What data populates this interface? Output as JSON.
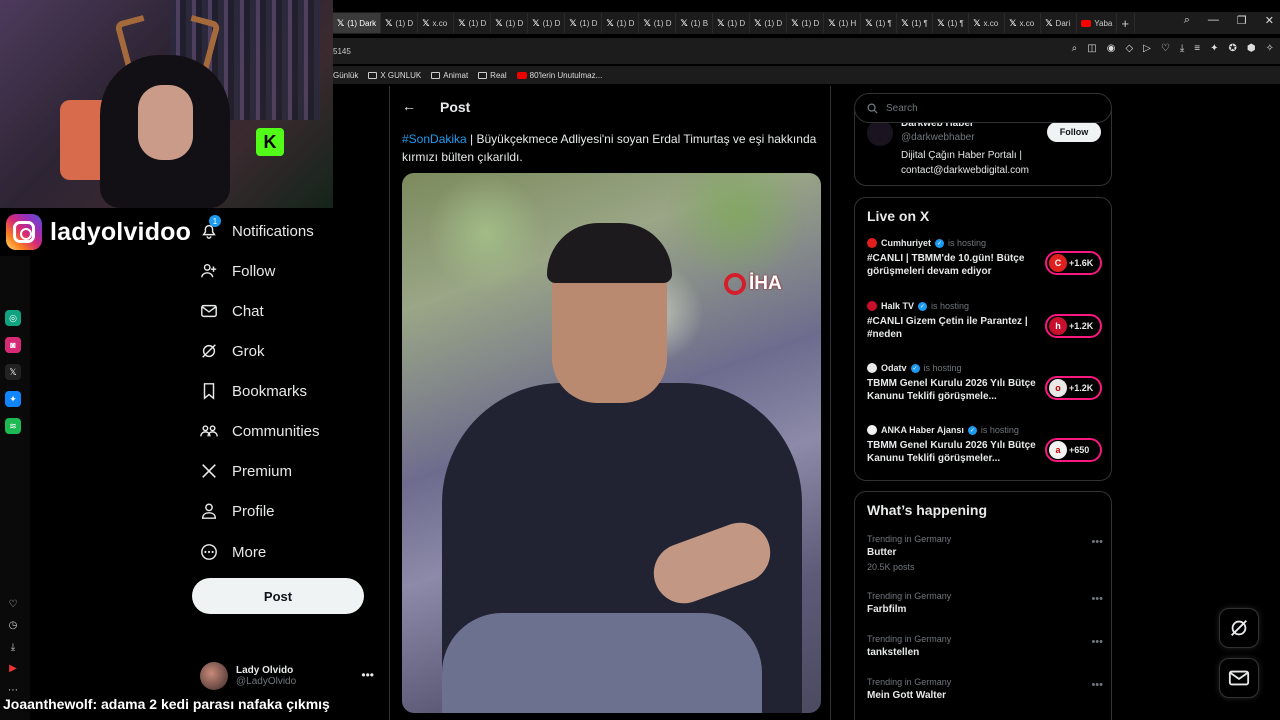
{
  "browser": {
    "tabs": [
      {
        "label": "(1) Dark",
        "icon": "x"
      },
      {
        "label": "(1) D",
        "icon": "x"
      },
      {
        "label": "x.co",
        "icon": "x"
      },
      {
        "label": "(1) D",
        "icon": "x"
      },
      {
        "label": "(1) D",
        "icon": "x"
      },
      {
        "label": "(1) D",
        "icon": "x"
      },
      {
        "label": "(1) D",
        "icon": "x"
      },
      {
        "label": "(1) D",
        "icon": "x"
      },
      {
        "label": "(1) D",
        "icon": "x"
      },
      {
        "label": "(1) B",
        "icon": "x"
      },
      {
        "label": "(1) D",
        "icon": "x"
      },
      {
        "label": "(1) D",
        "icon": "x"
      },
      {
        "label": "(1) D",
        "icon": "x"
      },
      {
        "label": "(1) H",
        "icon": "x"
      },
      {
        "label": "(1) ¶",
        "icon": "x"
      },
      {
        "label": "(1) ¶",
        "icon": "x"
      },
      {
        "label": "(1) ¶",
        "icon": "x"
      },
      {
        "label": "x.co",
        "icon": "x"
      },
      {
        "label": "x.co",
        "icon": "x"
      },
      {
        "label": "Dari",
        "icon": "x"
      },
      {
        "label": "Yaba",
        "icon": "youtube"
      }
    ],
    "url_fragment": "5145",
    "bookmarks": [
      {
        "label": "Günlük",
        "icon": "none"
      },
      {
        "label": "X GUNLUK",
        "icon": "folder"
      },
      {
        "label": "Animat",
        "icon": "folder"
      },
      {
        "label": "Real",
        "icon": "folder"
      },
      {
        "label": "80'lerin Unutulmaz...",
        "icon": "youtube"
      }
    ]
  },
  "overlay": {
    "instagram_handle": "ladyolvidoo",
    "chat_user": "Joaanthewolf:",
    "chat_text": "adama 2 kedi parası nafaka çıkmış",
    "kick_letter": "K"
  },
  "nav": {
    "notifications_badge": "1",
    "items": [
      {
        "label": "Notifications",
        "icon": "bell-icon"
      },
      {
        "label": "Follow",
        "icon": "person-plus-icon"
      },
      {
        "label": "Chat",
        "icon": "mail-icon"
      },
      {
        "label": "Grok",
        "icon": "grok-icon"
      },
      {
        "label": "Bookmarks",
        "icon": "bookmark-icon"
      },
      {
        "label": "Communities",
        "icon": "people-icon"
      },
      {
        "label": "Premium",
        "icon": "x-logo-icon"
      },
      {
        "label": "Profile",
        "icon": "person-icon"
      },
      {
        "label": "More",
        "icon": "more-circle-icon"
      }
    ],
    "post_button": "Post",
    "profile": {
      "name": "Lady Olvido",
      "handle": "@LadyOlvido"
    }
  },
  "post": {
    "header_title": "Post",
    "hashtag": "#SonDakika",
    "text": " | Büyükçekmece Adliyesi'ni soyan Erdal Timurtaş ve eşi hakkında kırmızı bülten çıkarıldı.",
    "watermark": "İHA"
  },
  "sidebar": {
    "search_placeholder": "Search",
    "follow_card": {
      "name": "Darkweb Haber",
      "handle": "@darkwebhaber",
      "bio": "Dijital Çağın Haber Portalı | contact@darkwebdigital.com",
      "follow_label": "Follow"
    },
    "live_title": "Live on X",
    "live": [
      {
        "host": "Cumhuriyet",
        "status": "is hosting",
        "title": "#CANLI | TBMM'de 10.gün! Bütçe görüşmeleri devam ediyor",
        "count": "+1.6K",
        "color": "#e0201e",
        "glyph": "C"
      },
      {
        "host": "Halk TV",
        "status": "is hosting",
        "title": "#CANLI Gizem Çetin ile Parantez | #neden",
        "count": "+1.2K",
        "color": "#c8102e",
        "glyph": "h"
      },
      {
        "host": "Odatv",
        "status": "is hosting",
        "title": "TBMM Genel Kurulu 2026 Yılı Bütçe Kanunu Teklifi görüşmele...",
        "count": "+1.2K",
        "color": "#e8e8e8",
        "glyph": "o"
      },
      {
        "host": "ANKA Haber Ajansı",
        "status": "is hosting",
        "title": "TBMM Genel Kurulu 2026 Yılı Bütçe Kanunu Teklifi görüşmeler...",
        "count": "+650",
        "color": "#f2f2f2",
        "glyph": "a"
      }
    ],
    "trends_title": "What’s happening",
    "trends": [
      {
        "context": "Trending in Germany",
        "name": "Butter",
        "count": "20.5K posts"
      },
      {
        "context": "Trending in Germany",
        "name": "Farbfilm",
        "count": ""
      },
      {
        "context": "Trending in Germany",
        "name": "tankstellen",
        "count": ""
      },
      {
        "context": "Trending in Germany",
        "name": "Mein Gott Walter",
        "count": ""
      }
    ]
  },
  "colors": {
    "accent": "#1d9bf0",
    "live_ring": "#f91880",
    "background": "#000000"
  }
}
